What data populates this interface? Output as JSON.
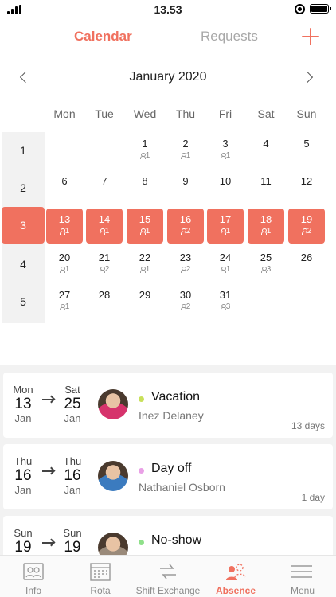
{
  "status_bar": {
    "time": "13.53"
  },
  "header": {
    "tabs": [
      "Calendar",
      "Requests"
    ],
    "add_icon": "plus-icon"
  },
  "calendar": {
    "month": "January 2020",
    "weekdays": [
      "Mon",
      "Tue",
      "Wed",
      "Thu",
      "Fri",
      "Sat",
      "Sun"
    ],
    "weeks": [
      {
        "number": "1",
        "selected": false,
        "days": [
          null,
          null,
          {
            "d": "1",
            "c": "1"
          },
          {
            "d": "2",
            "c": "1"
          },
          {
            "d": "3",
            "c": "1"
          },
          {
            "d": "4"
          },
          {
            "d": "5"
          }
        ]
      },
      {
        "number": "2",
        "selected": false,
        "days": [
          {
            "d": "6"
          },
          {
            "d": "7"
          },
          {
            "d": "8"
          },
          {
            "d": "9"
          },
          {
            "d": "10"
          },
          {
            "d": "11"
          },
          {
            "d": "12"
          }
        ]
      },
      {
        "number": "3",
        "selected": true,
        "days": [
          {
            "d": "13",
            "c": "1"
          },
          {
            "d": "14",
            "c": "1"
          },
          {
            "d": "15",
            "c": "1"
          },
          {
            "d": "16",
            "c": "2"
          },
          {
            "d": "17",
            "c": "1"
          },
          {
            "d": "18",
            "c": "1"
          },
          {
            "d": "19",
            "c": "2"
          }
        ]
      },
      {
        "number": "4",
        "selected": false,
        "days": [
          {
            "d": "20",
            "c": "1"
          },
          {
            "d": "21",
            "c": "2"
          },
          {
            "d": "22",
            "c": "1"
          },
          {
            "d": "23",
            "c": "2"
          },
          {
            "d": "24",
            "c": "1"
          },
          {
            "d": "25",
            "c": "3"
          },
          {
            "d": "26"
          }
        ]
      },
      {
        "number": "5",
        "selected": false,
        "days": [
          {
            "d": "27",
            "c": "1"
          },
          {
            "d": "28"
          },
          {
            "d": "29"
          },
          {
            "d": "30",
            "c": "2"
          },
          {
            "d": "31",
            "c": "3"
          },
          null,
          null
        ]
      }
    ]
  },
  "absences": [
    {
      "from": {
        "dow": "Mon",
        "day": "13",
        "mon": "Jan"
      },
      "to": {
        "dow": "Sat",
        "day": "25",
        "mon": "Jan"
      },
      "type": "Vacation",
      "type_color": "#c8e05a",
      "person": "Inez Delaney",
      "duration": "13 days",
      "avatar_color": "#d6336c"
    },
    {
      "from": {
        "dow": "Thu",
        "day": "16",
        "mon": "Jan"
      },
      "to": {
        "dow": "Thu",
        "day": "16",
        "mon": "Jan"
      },
      "type": "Day off",
      "type_color": "#e9a0e6",
      "person": "Nathaniel Osborn",
      "duration": "1 day",
      "avatar_color": "#3b7bbf"
    },
    {
      "from": {
        "dow": "Sun",
        "day": "19",
        "mon": ""
      },
      "to": {
        "dow": "Sun",
        "day": "19",
        "mon": ""
      },
      "type": "No-show",
      "type_color": "#8fe08a",
      "person": "",
      "duration": "",
      "avatar_color": "#9a8a7a"
    }
  ],
  "nav": {
    "items": [
      "Info",
      "Rota",
      "Shift Exchange",
      "Absence",
      "Menu"
    ],
    "active": "Absence"
  },
  "colors": {
    "accent": "#f0715f"
  }
}
